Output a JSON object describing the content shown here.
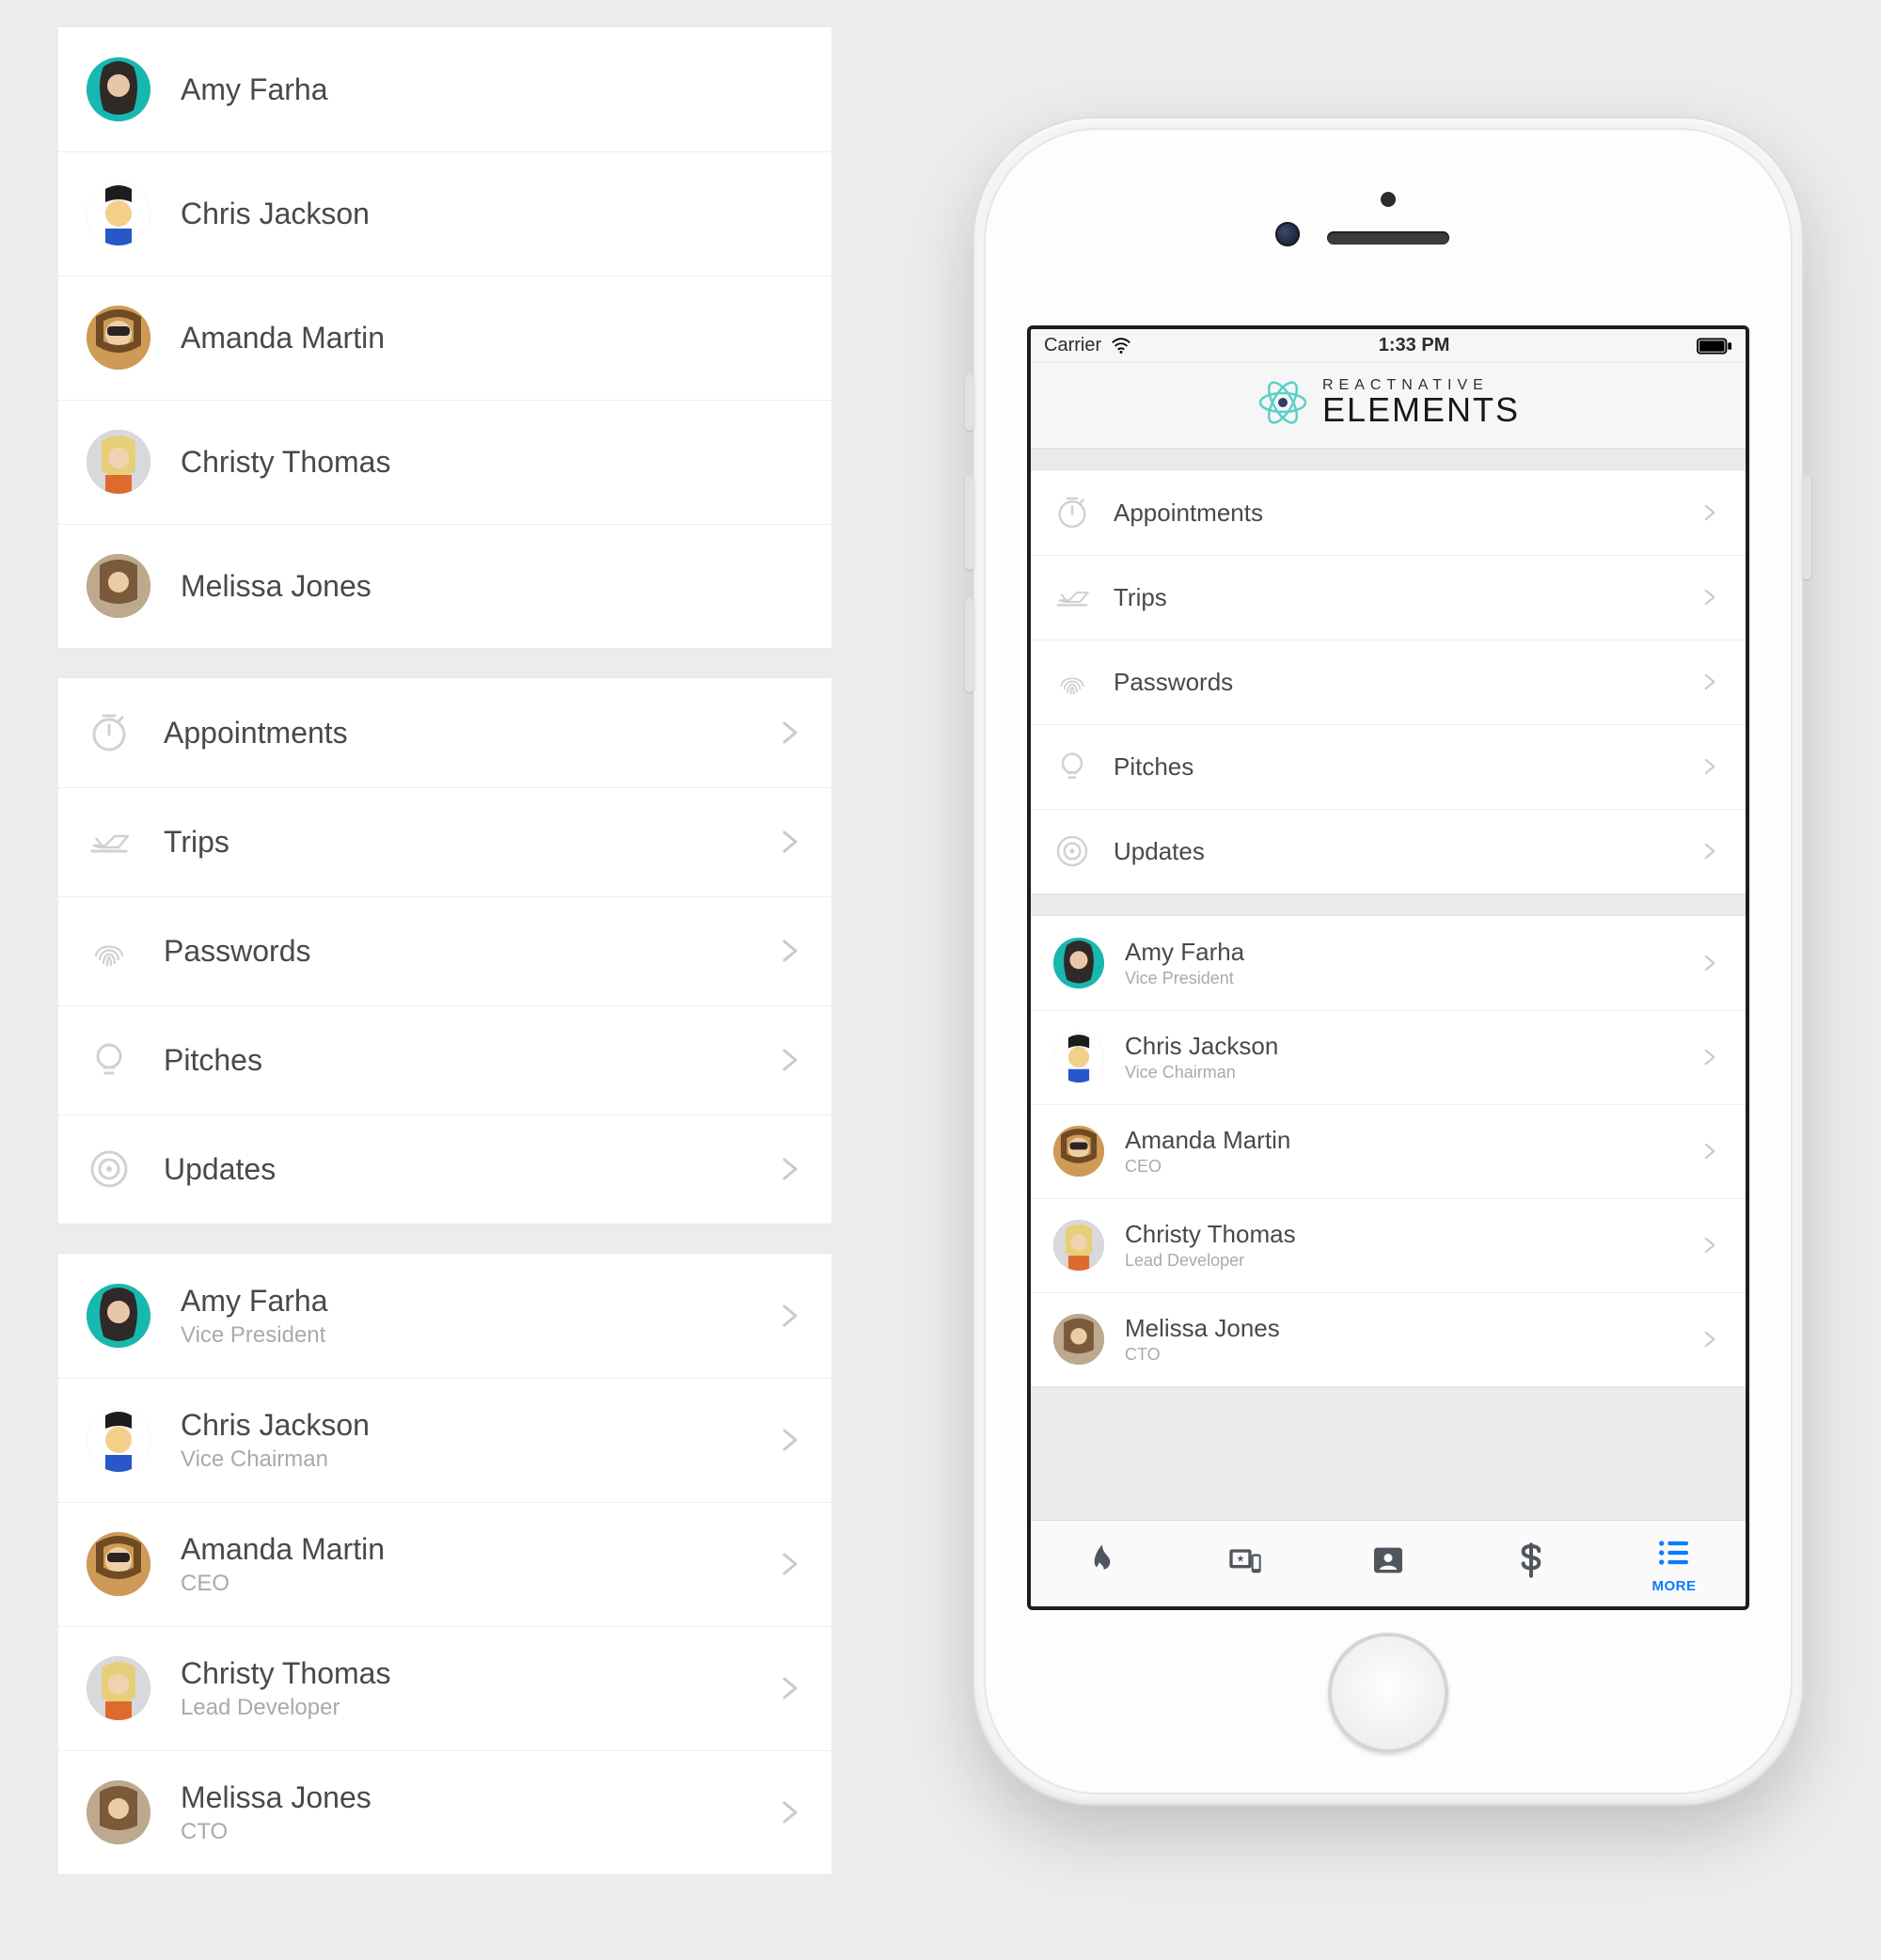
{
  "contacts_simple": [
    {
      "name": "Amy Farha"
    },
    {
      "name": "Chris Jackson"
    },
    {
      "name": "Amanda Martin"
    },
    {
      "name": "Christy Thomas"
    },
    {
      "name": "Melissa Jones"
    }
  ],
  "categories": [
    {
      "icon": "timer-icon",
      "label": "Appointments"
    },
    {
      "icon": "plane-icon",
      "label": "Trips"
    },
    {
      "icon": "fingerprint-icon",
      "label": "Passwords"
    },
    {
      "icon": "bulb-icon",
      "label": "Pitches"
    },
    {
      "icon": "target-icon",
      "label": "Updates"
    }
  ],
  "contacts_detailed": [
    {
      "name": "Amy Farha",
      "title": "Vice President"
    },
    {
      "name": "Chris Jackson",
      "title": "Vice Chairman"
    },
    {
      "name": "Amanda Martin",
      "title": "CEO"
    },
    {
      "name": "Christy Thomas",
      "title": "Lead Developer"
    },
    {
      "name": "Melissa Jones",
      "title": "CTO"
    }
  ],
  "phone": {
    "status": {
      "carrier": "Carrier",
      "time": "1:33 PM"
    },
    "brand": {
      "top": "REACTNATIVE",
      "bottom": "ELEMENTS"
    },
    "tabs": [
      {
        "icon": "flame-icon",
        "label": ""
      },
      {
        "icon": "devices-icon",
        "label": ""
      },
      {
        "icon": "contact-icon",
        "label": ""
      },
      {
        "icon": "dollar-icon",
        "label": ""
      },
      {
        "icon": "list-icon",
        "label": "MORE",
        "active": true
      }
    ]
  }
}
